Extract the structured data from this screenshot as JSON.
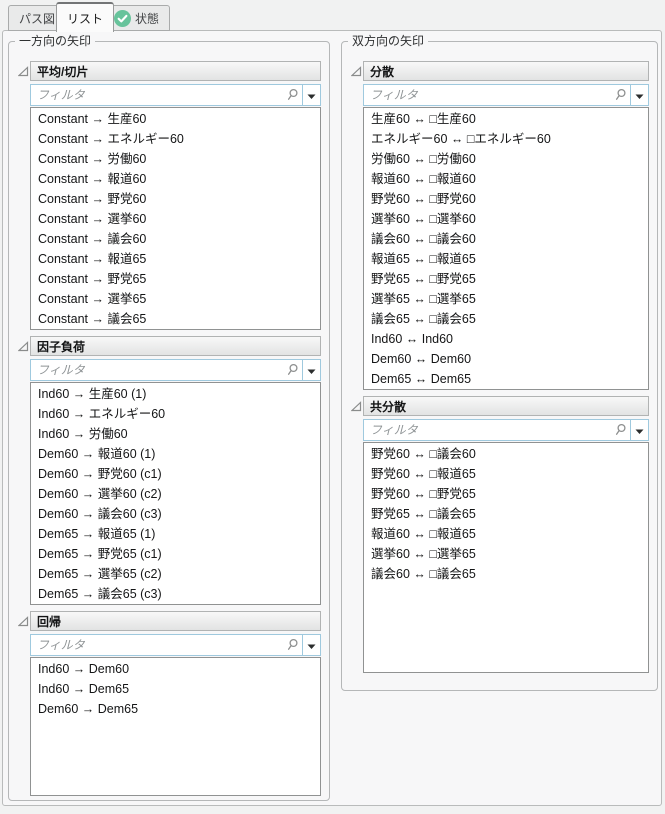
{
  "tabs": [
    {
      "id": "pass-diagram",
      "label": "パス図",
      "active": false
    },
    {
      "id": "list",
      "label": "リスト",
      "active": true
    },
    {
      "id": "status",
      "label": "状態",
      "active": false,
      "icon": "check-circle-icon"
    }
  ],
  "panels": {
    "left": {
      "title": "一方向の矢印",
      "sections": [
        {
          "id": "mean-intercept",
          "title": "平均/切片",
          "filter_placeholder": "フィルタ",
          "items": [
            "Constant → 生産60",
            "Constant → エネルギー60",
            "Constant → 労働60",
            "Constant → 報道60",
            "Constant → 野党60",
            "Constant → 選挙60",
            "Constant → 議会60",
            "Constant → 報道65",
            "Constant → 野党65",
            "Constant → 選挙65",
            "Constant → 議会65"
          ]
        },
        {
          "id": "factor-loading",
          "title": "因子負荷",
          "filter_placeholder": "フィルタ",
          "items": [
            "Ind60 → 生産60 (1)",
            "Ind60 → エネルギー60",
            "Ind60 → 労働60",
            "Dem60 → 報道60 (1)",
            "Dem60 → 野党60 (c1)",
            "Dem60 → 選挙60 (c2)",
            "Dem60 → 議会60 (c3)",
            "Dem65 → 報道65 (1)",
            "Dem65 → 野党65 (c1)",
            "Dem65 → 選挙65 (c2)",
            "Dem65 → 議会65 (c3)"
          ]
        },
        {
          "id": "regression",
          "title": "回帰",
          "filter_placeholder": "フィルタ",
          "items": [
            "Ind60 → Dem60",
            "Ind60 → Dem65",
            "Dem60 → Dem65"
          ]
        }
      ]
    },
    "right": {
      "title": "双方向の矢印",
      "sections": [
        {
          "id": "variance",
          "title": "分散",
          "filter_placeholder": "フィルタ",
          "items": [
            "生産60 ↔ □生産60",
            "エネルギー60 ↔ □エネルギー60",
            "労働60 ↔ □労働60",
            "報道60 ↔ □報道60",
            "野党60 ↔ □野党60",
            "選挙60 ↔ □選挙60",
            "議会60 ↔ □議会60",
            "報道65 ↔ □報道65",
            "野党65 ↔ □野党65",
            "選挙65 ↔ □選挙65",
            "議会65 ↔ □議会65",
            "Ind60 ↔ Ind60",
            "Dem60 ↔ Dem60",
            "Dem65 ↔ Dem65"
          ]
        },
        {
          "id": "covariance",
          "title": "共分散",
          "filter_placeholder": "フィルタ",
          "items": [
            "野党60 ↔ □議会60",
            "野党60 ↔ □報道65",
            "野党60 ↔ □野党65",
            "野党65 ↔ □議会65",
            "報道60 ↔ □報道65",
            "選挙60 ↔ □選挙65",
            "議会60 ↔ □議会65"
          ]
        }
      ]
    }
  },
  "colors": {
    "status_green": "#67c39b",
    "filter_border": "#9fc9de",
    "panel_bg": "#f7f7f8",
    "header_gradient_top": "#f8f8f8",
    "header_gradient_bottom": "#e2e3e3"
  }
}
